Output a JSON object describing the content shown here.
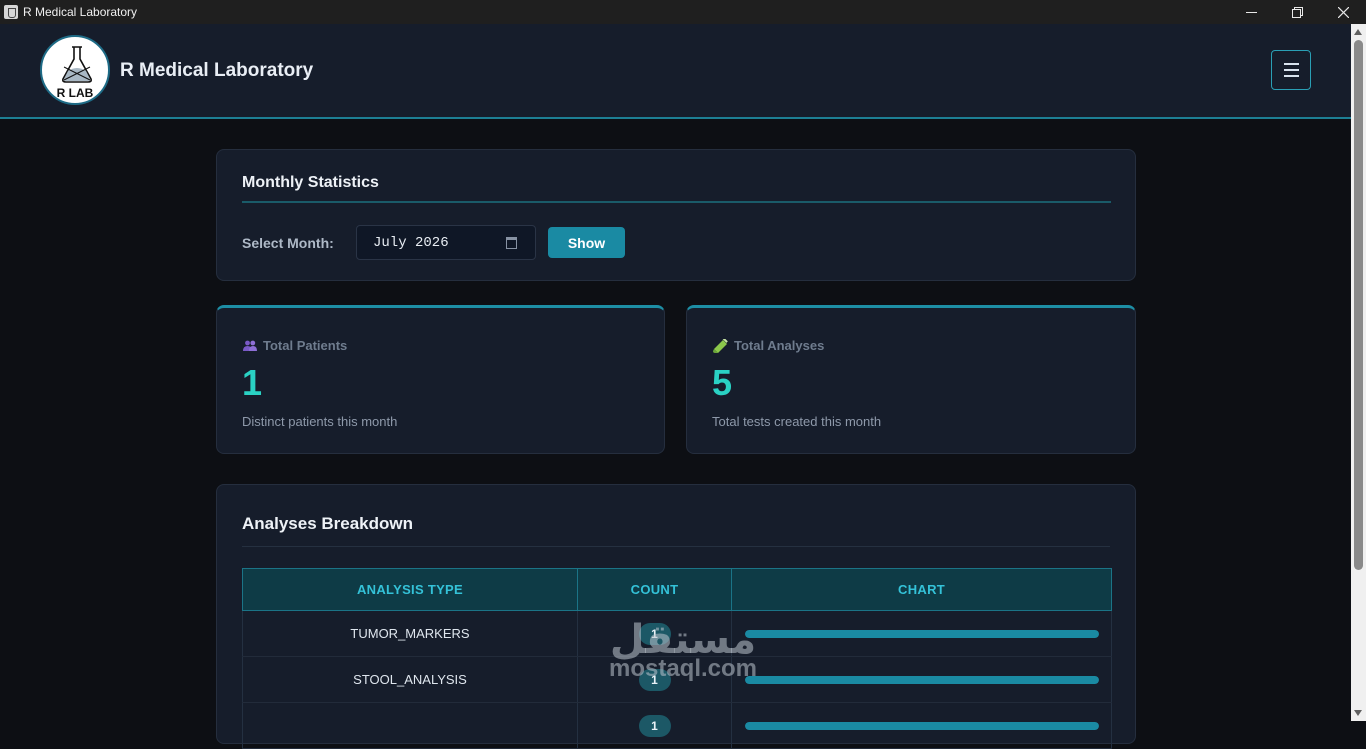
{
  "window": {
    "title": "R Medical Laboratory"
  },
  "header": {
    "logo_text": "R LAB",
    "brand_name": "R Medical Laboratory"
  },
  "monthly": {
    "title": "Monthly Statistics",
    "select_label": "Select Month:",
    "month_value": "July 2026",
    "show_label": "Show"
  },
  "stats": {
    "patients": {
      "label": "Total Patients",
      "value": "1",
      "description": "Distinct patients this month"
    },
    "analyses": {
      "label": "Total Analyses",
      "value": "5",
      "description": "Total tests created this month"
    }
  },
  "breakdown": {
    "title": "Analyses Breakdown",
    "columns": [
      "ANALYSIS TYPE",
      "COUNT",
      "CHART"
    ],
    "rows": [
      {
        "type": "TUMOR_MARKERS",
        "count": "1",
        "fill": 1.0
      },
      {
        "type": "STOOL_ANALYSIS",
        "count": "1",
        "fill": 1.0
      },
      {
        "type": "",
        "count": "1",
        "fill": 1.0
      }
    ]
  },
  "watermark": {
    "arabic": "مستقل",
    "latin": "mostaql.com"
  },
  "colors": {
    "accent": "#1a8aa3",
    "stat_value": "#2ad2c4",
    "background": "#0d0f14",
    "card": "#161d2b"
  }
}
